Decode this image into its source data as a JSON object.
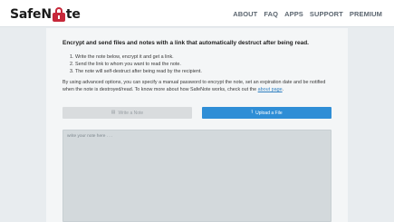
{
  "header": {
    "logo_prefix": "SafeN",
    "logo_suffix": "te",
    "logo_icon": "padlock-icon",
    "nav": [
      "ABOUT",
      "FAQ",
      "APPS",
      "SUPPORT",
      "PREMIUM"
    ]
  },
  "main": {
    "headline": "Encrypt and send files and notes with a link that automatically destruct after being read.",
    "steps": [
      "1. Write the note below, encrypt it and get a link.",
      "2. Send the link to whom you want to read the note.",
      "3. The note will self-destruct after being read by the recipient."
    ],
    "description": "By using advanced options, you can specify a manual password to encrypt the note, set an expiration date and be notified when the note is destroyed/read. To know more about how SafeNote works, check out the ",
    "about_link": "about page",
    "description_end": ".",
    "write_note_label": "Write a Note",
    "write_note_icon": "note-icon",
    "upload_file_label": "Upload a File",
    "upload_file_icon": "upload-icon",
    "note_placeholder": "write your note here . . ."
  },
  "colors": {
    "brand": "#c7283a",
    "primary_button": "#2f8ed6",
    "link": "#2f7fc0"
  }
}
